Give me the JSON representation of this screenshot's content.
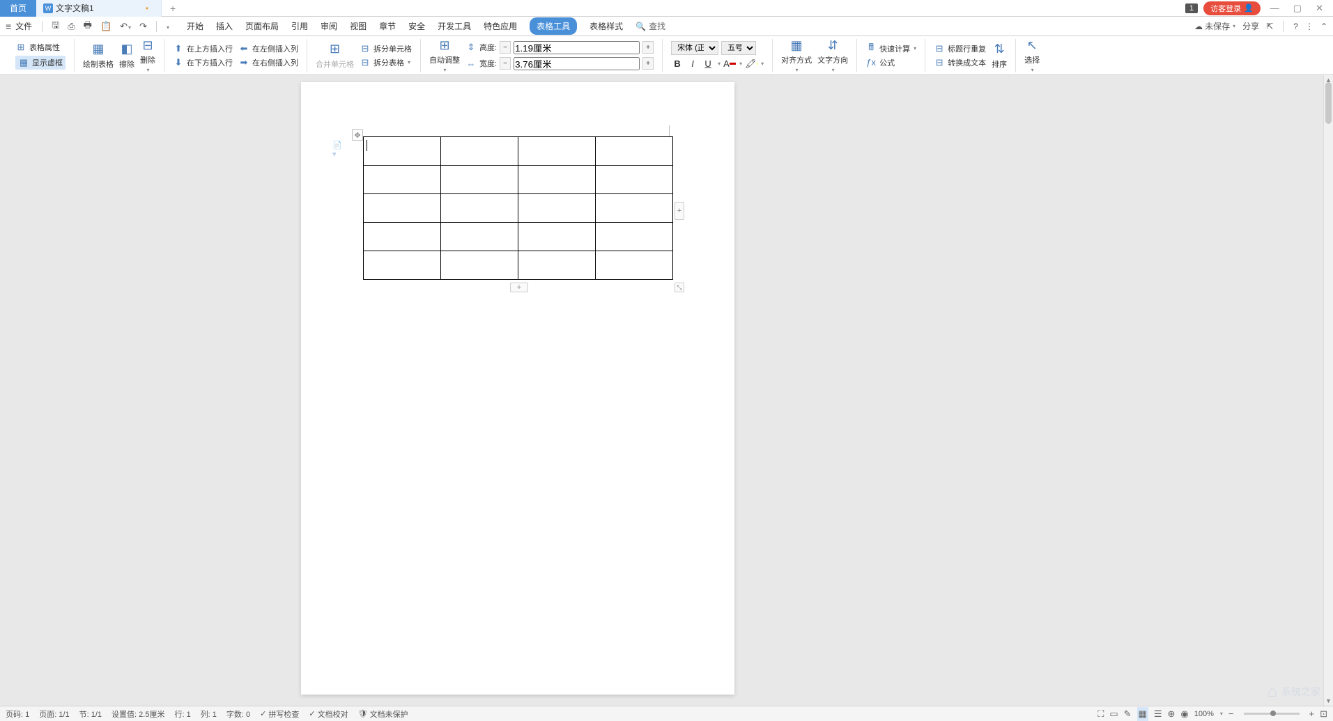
{
  "title": {
    "tab_home": "首页",
    "tab_doc": "文字文稿1",
    "badge": "1",
    "login": "访客登录"
  },
  "menu": {
    "file": "文件",
    "tabs": {
      "start": "开始",
      "insert": "插入",
      "layout": "页面布局",
      "refs": "引用",
      "review": "审阅",
      "view": "视图",
      "chapter": "章节",
      "security": "安全",
      "dev": "开发工具",
      "special": "特色应用",
      "table_tools": "表格工具",
      "table_style": "表格样式"
    },
    "search": "查找",
    "unsaved": "未保存",
    "share": "分享"
  },
  "ribbon": {
    "table_props": "表格属性",
    "show_lines": "显示虚框",
    "draw_table": "绘制表格",
    "erase": "擦除",
    "delete": "删除",
    "insert_above": "在上方插入行",
    "insert_below": "在下方插入行",
    "insert_left": "在左侧插入列",
    "insert_right": "在右侧插入列",
    "merge_cells": "合并单元格",
    "split_cells": "拆分单元格",
    "split_table": "拆分表格",
    "auto_fit": "自动调整",
    "height_label": "高度:",
    "height_value": "1.19厘米",
    "width_label": "宽度:",
    "width_value": "3.76厘米",
    "font_name": "宋体 (正文)",
    "font_size": "五号",
    "align": "对齐方式",
    "text_dir": "文字方向",
    "quick_calc": "快速计算",
    "formula": "公式",
    "header_repeat": "标题行重复",
    "to_text": "转换成文本",
    "sort": "排序",
    "select": "选择"
  },
  "status": {
    "page_num": "页码: 1",
    "page": "页面: 1/1",
    "section": "节: 1/1",
    "pos": "设置值: 2.5厘米",
    "row": "行: 1",
    "col": "列: 1",
    "words": "字数: 0",
    "spell": "拼写检查",
    "proof": "文档校对",
    "protect": "文档未保护",
    "zoom": "100%"
  },
  "table": {
    "rows": 5,
    "cols": 4
  },
  "watermark": "系统之家"
}
